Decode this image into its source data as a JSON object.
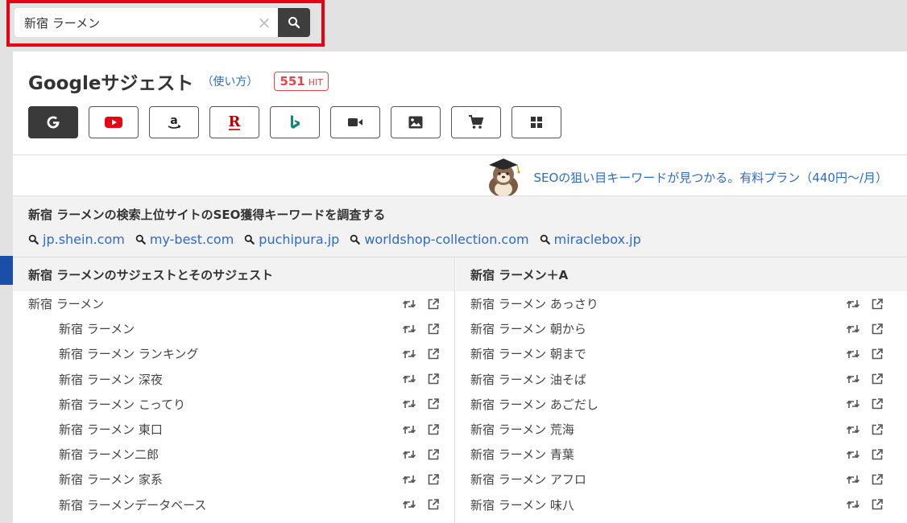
{
  "search": {
    "value": "新宿 ラーメン",
    "clear_symbol": "×"
  },
  "header": {
    "title": "Googleサジェスト",
    "howto": "（使い方）",
    "hit_count": "551",
    "hit_label": "HIT"
  },
  "engines": [
    {
      "name": "google-icon",
      "active": true
    },
    {
      "name": "youtube-icon",
      "active": false
    },
    {
      "name": "amazon-icon",
      "active": false
    },
    {
      "name": "rakuten-icon",
      "active": false
    },
    {
      "name": "bing-icon",
      "active": false
    },
    {
      "name": "video-icon",
      "active": false
    },
    {
      "name": "image-icon",
      "active": false
    },
    {
      "name": "shopping-cart-icon",
      "active": false
    },
    {
      "name": "grid-icon",
      "active": false
    }
  ],
  "promo": {
    "text": "SEOの狙い目キーワードが見つかる。有料プラン（440円〜/月）"
  },
  "seo": {
    "title": "新宿 ラーメンの検索上位サイトのSEO獲得キーワードを調査する",
    "sites": [
      "jp.shein.com",
      "my-best.com",
      "puchipura.jp",
      "worldshop-collection.com",
      "miraclebox.jp"
    ]
  },
  "left_column": {
    "header": "新宿 ラーメンのサジェストとそのサジェスト",
    "items": [
      {
        "text": "新宿 ラーメン",
        "indent": false
      },
      {
        "text": "新宿 ラーメン",
        "indent": true
      },
      {
        "text": "新宿 ラーメン ランキング",
        "indent": true
      },
      {
        "text": "新宿 ラーメン 深夜",
        "indent": true
      },
      {
        "text": "新宿 ラーメン こってり",
        "indent": true
      },
      {
        "text": "新宿 ラーメン 東口",
        "indent": true
      },
      {
        "text": "新宿 ラーメン二郎",
        "indent": true
      },
      {
        "text": "新宿 ラーメン 家系",
        "indent": true
      },
      {
        "text": "新宿 ラーメンデータベース",
        "indent": true
      }
    ]
  },
  "right_column": {
    "header": "新宿 ラーメン＋A",
    "items": [
      "新宿 ラーメン あっさり",
      "新宿 ラーメン 朝から",
      "新宿 ラーメン 朝まで",
      "新宿 ラーメン 油そば",
      "新宿 ラーメン あごだし",
      "新宿 ラーメン 荒海",
      "新宿 ラーメン 青葉",
      "新宿 ラーメン アフロ",
      "新宿 ラーメン 味八"
    ]
  },
  "colors": {
    "accent_link": "#2c6bc6",
    "highlight_border": "#e60012",
    "hit_red": "#e6464b",
    "dark_button": "#3a3a3a"
  }
}
